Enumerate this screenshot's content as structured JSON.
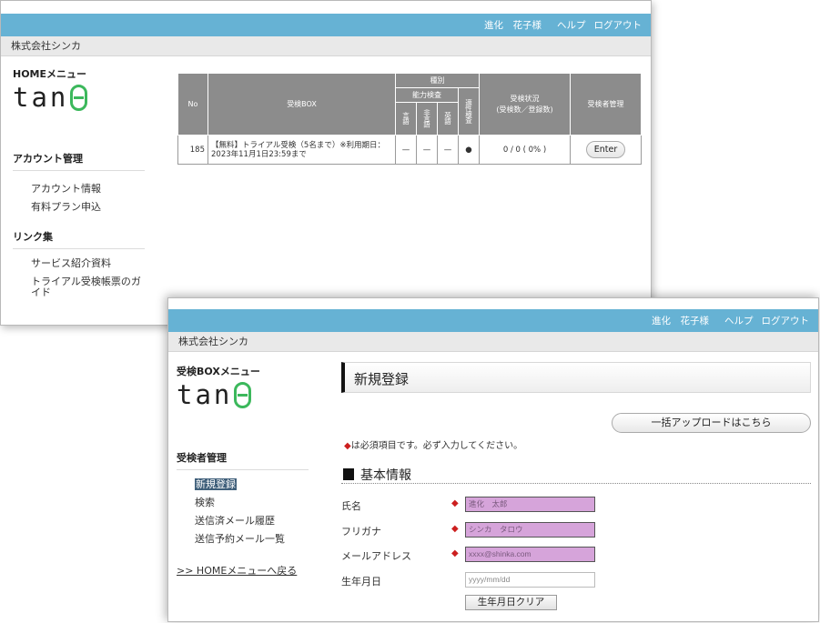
{
  "win1": {
    "header": {
      "user": "進化　花子様",
      "help": "ヘルプ",
      "logout": "ログアウト"
    },
    "company": "株式会社シンカ",
    "menu_title": "HOMEメニュー",
    "logo": {
      "text": "tan",
      "mark": "θ"
    },
    "account_section": {
      "title": "アカウント管理",
      "items": [
        "アカウント情報",
        "有料プラン申込"
      ]
    },
    "links_section": {
      "title": "リンク集",
      "items": [
        "サービス紹介資料",
        "トライアル受検帳票のガイド"
      ]
    },
    "table": {
      "headers": {
        "no": "No",
        "box": "受検BOX",
        "category": "種別",
        "ability": "能力検査",
        "japanese": "言語",
        "nonverbal": "非言語",
        "english": "英語",
        "aptitude": "適性検査",
        "status": "受検状況\n(受検数／登録数)",
        "manage": "受検者管理"
      },
      "rows": [
        {
          "no": "185",
          "box": "【無料】トライアル受検（5名まで）※利用期日：2023年11月1日23:59まで",
          "japanese": "—",
          "nonverbal": "—",
          "english": "—",
          "aptitude": "●",
          "status": "0 / 0 ( 0% )",
          "action": "Enter"
        }
      ]
    }
  },
  "win2": {
    "header": {
      "user": "進化　花子様",
      "help": "ヘルプ",
      "logout": "ログアウト"
    },
    "company": "株式会社シンカ",
    "menu_title": "受検BOXメニュー",
    "logo": {
      "text": "tan",
      "mark": "θ"
    },
    "manage_section": {
      "title": "受検者管理",
      "items": [
        "新規登録",
        "検索",
        "送信済メール履歴",
        "送信予約メール一覧"
      ]
    },
    "back_link": ">> HOMEメニューへ戻る",
    "page_title": "新規登録",
    "bulk_upload": "一括アップロードはこちら",
    "required_note": "は必須項目です。必ず入力してください。",
    "required_mark": "◆",
    "section_title": "基本情報",
    "fields": [
      {
        "label": "氏名",
        "required": true,
        "placeholder": "進化　太郎"
      },
      {
        "label": "フリガナ",
        "required": true,
        "placeholder": "シンカ　タロウ"
      },
      {
        "label": "メールアドレス",
        "required": true,
        "placeholder": "xxxx@shinka.com"
      },
      {
        "label": "生年月日",
        "required": false,
        "placeholder": "yyyy/mm/dd"
      }
    ],
    "clear_birthday": "生年月日クリア"
  },
  "colors": {
    "topbar": "#66b2d4",
    "header_cell": "#8c8c8c",
    "required": "#cc1f1f",
    "required_field": "#d6a4da",
    "logo_accent": "#3cb85c"
  }
}
